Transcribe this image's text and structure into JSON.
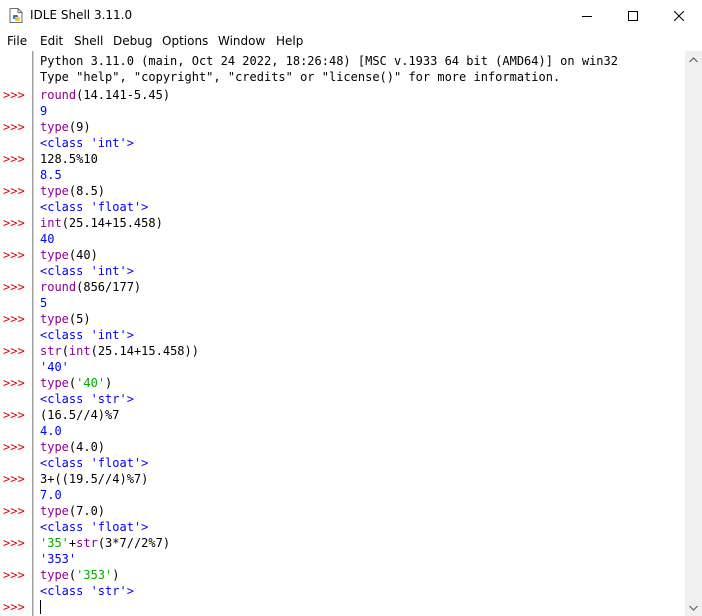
{
  "window": {
    "title": "IDLE Shell 3.11.0",
    "icon": "python-idle-icon",
    "controls": [
      "minimize-icon",
      "maximize-icon",
      "close-icon"
    ]
  },
  "menu": [
    "File",
    "Edit",
    "Shell",
    "Debug",
    "Options",
    "Window",
    "Help"
  ],
  "prompt": ">>>",
  "banner": [
    "Python 3.11.0 (main, Oct 24 2022, 18:26:48) [MSC v.1933 64 bit (AMD64)] on win32",
    "Type \"help\", \"copyright\", \"credits\" or \"license()\" for more information."
  ],
  "session": [
    {
      "input": "round(14.141-5.45)",
      "output": "9"
    },
    {
      "input": "type(9)",
      "output": "<class 'int'>"
    },
    {
      "input": "128.5%10",
      "output": "8.5"
    },
    {
      "input": "type(8.5)",
      "output": "<class 'float'>"
    },
    {
      "input": "int(25.14+15.458)",
      "output": "40"
    },
    {
      "input": "type(40)",
      "output": "<class 'int'>"
    },
    {
      "input": "round(856/177)",
      "output": "5"
    },
    {
      "input": "type(5)",
      "output": "<class 'int'>"
    },
    {
      "input": "str(int(25.14+15.458))",
      "output": "'40'"
    },
    {
      "input": "type('40')",
      "output": "<class 'str'>"
    },
    {
      "input": "(16.5//4)%7",
      "output": "4.0"
    },
    {
      "input": "type(4.0)",
      "output": "<class 'float'>"
    },
    {
      "input": "3+((19.5//4)%7)",
      "output": "7.0"
    },
    {
      "input": "type(7.0)",
      "output": "<class 'float'>"
    },
    {
      "input": "'35'+str(3*7//2%7)",
      "output": "'353'"
    },
    {
      "input": "type('353')",
      "output": "<class 'str'>"
    }
  ],
  "colors": {
    "prompt": "#e00000",
    "builtin": "#900090",
    "string": "#00aa00",
    "output": "#0000ff"
  }
}
